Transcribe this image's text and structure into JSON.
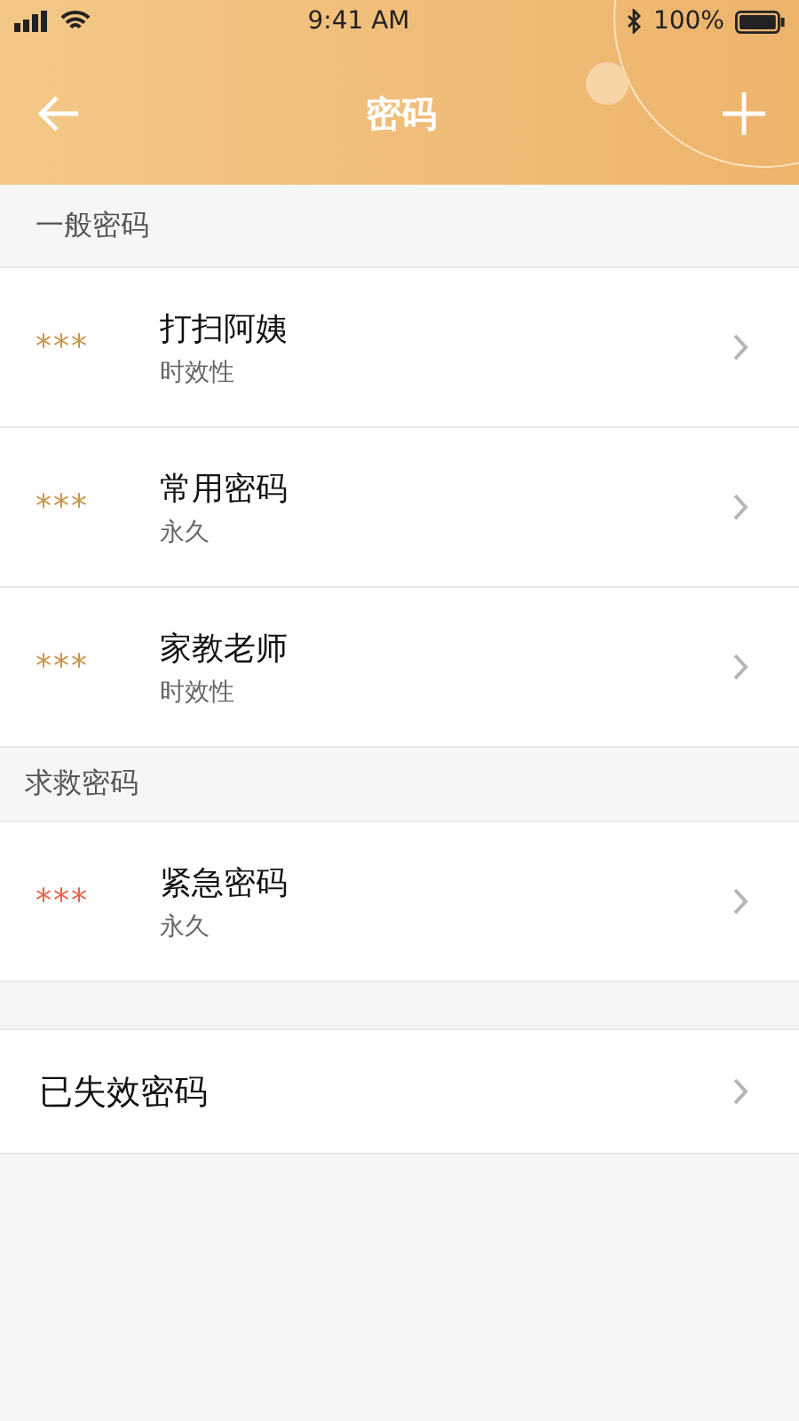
{
  "status_bar": {
    "time": "9:41 AM",
    "battery": "100%"
  },
  "nav": {
    "title": "密码"
  },
  "sections": [
    {
      "header": "一般密码",
      "items": [
        {
          "mask": "***",
          "color": "#c9954a",
          "name": "打扫阿姨",
          "validity": "时效性"
        },
        {
          "mask": "***",
          "color": "#c9954a",
          "name": "常用密码",
          "validity": "永久"
        },
        {
          "mask": "***",
          "color": "#c9954a",
          "name": "家教老师",
          "validity": "时效性"
        }
      ]
    },
    {
      "header": "求救密码",
      "items": [
        {
          "mask": "***",
          "color": "#e8634a",
          "name": "紧急密码",
          "validity": "永久"
        }
      ]
    }
  ],
  "expired": {
    "label": "已失效密码"
  }
}
